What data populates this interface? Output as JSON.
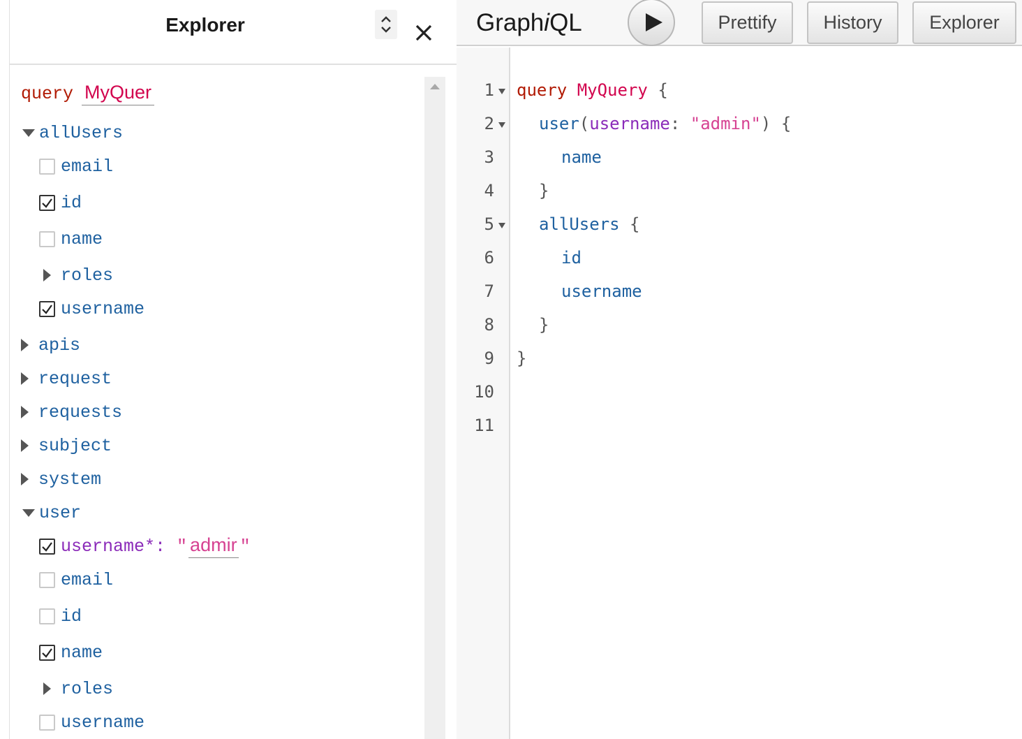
{
  "explorer": {
    "title": "Explorer",
    "operation_keyword": "query",
    "operation_name": "MyQuer",
    "tree": {
      "allUsers": {
        "label": "allUsers",
        "fields": [
          {
            "label": "email",
            "checked": false
          },
          {
            "label": "id",
            "checked": true
          },
          {
            "label": "name",
            "checked": false
          },
          {
            "label": "roles"
          },
          {
            "label": "username",
            "checked": true
          }
        ]
      },
      "collapsed": [
        "apis",
        "request",
        "requests",
        "subject",
        "system"
      ],
      "user": {
        "label": "user",
        "arg_label": "username*:",
        "arg_quote_open": "\"",
        "arg_value": "admir",
        "arg_quote_close": "\"",
        "fields": [
          {
            "label": "email",
            "checked": false
          },
          {
            "label": "id",
            "checked": false
          },
          {
            "label": "name",
            "checked": true
          },
          {
            "label": "roles"
          },
          {
            "label": "username",
            "checked": false
          }
        ]
      }
    }
  },
  "toolbar": {
    "title_pre": "Graph",
    "title_italic": "i",
    "title_post": "QL",
    "prettify_label": "Prettify",
    "history_label": "History",
    "explorer_label": "Explorer"
  },
  "editor": {
    "line_numbers": [
      "1",
      "2",
      "3",
      "4",
      "5",
      "6",
      "7",
      "8",
      "9",
      "10",
      "11"
    ],
    "lines": {
      "l1": {
        "kw": "query",
        "name": "MyQuery",
        "brace": "{"
      },
      "l2": {
        "field": "user",
        "paren_open": "(",
        "arg": "username",
        "colon": ":",
        "str": "\"admin\"",
        "paren_close": ")",
        "brace": "{"
      },
      "l3": {
        "field": "name"
      },
      "l4": {
        "brace": "}"
      },
      "l5": {
        "field": "allUsers",
        "brace": "{"
      },
      "l6": {
        "field": "id"
      },
      "l7": {
        "field": "username"
      },
      "l8": {
        "brace": "}"
      },
      "l9": {
        "brace": "}"
      }
    }
  }
}
